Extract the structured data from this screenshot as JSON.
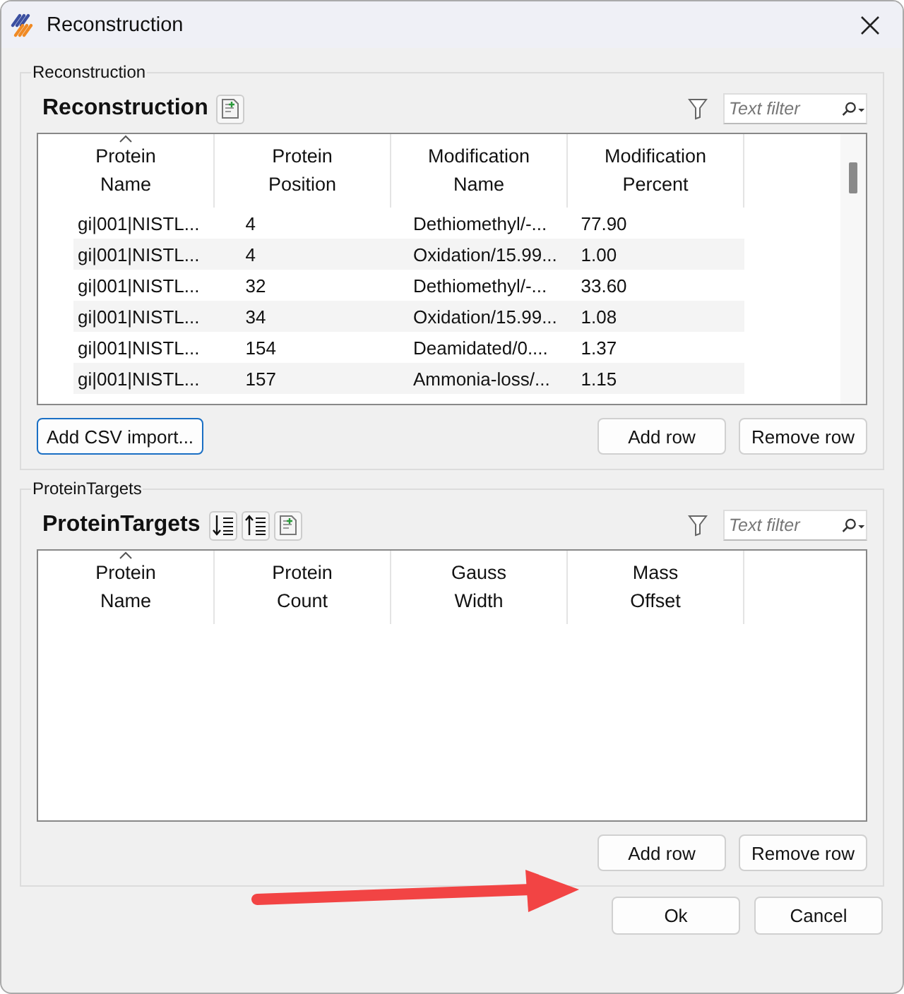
{
  "window": {
    "title": "Reconstruction"
  },
  "groups": [
    {
      "label": "Reconstruction",
      "title": "Reconstruction",
      "tools": [
        {
          "kind": "export"
        }
      ],
      "filter": {
        "placeholder": "Text filter"
      },
      "columns": [
        {
          "label": "Protein\nName",
          "sorted": true
        },
        {
          "label": "Protein\nPosition",
          "sorted": false
        },
        {
          "label": "Modification\nName",
          "sorted": false
        },
        {
          "label": "Modification\nPercent",
          "sorted": false
        }
      ],
      "rows": [
        [
          "gi|001|NISTL...",
          "4",
          "Dethiomethyl/-...",
          "77.90"
        ],
        [
          "gi|001|NISTL...",
          "4",
          "Oxidation/15.99...",
          "1.00"
        ],
        [
          "gi|001|NISTL...",
          "32",
          "Dethiomethyl/-...",
          "33.60"
        ],
        [
          "gi|001|NISTL...",
          "34",
          "Oxidation/15.99...",
          "1.08"
        ],
        [
          "gi|001|NISTL...",
          "154",
          "Deamidated/0....",
          "1.37"
        ],
        [
          "gi|001|NISTL...",
          "157",
          "Ammonia-loss/...",
          "1.15"
        ]
      ],
      "left_button": "Add CSV import...",
      "buttons": [
        "Add row",
        "Remove row"
      ]
    },
    {
      "label": "ProteinTargets",
      "title": "ProteinTargets",
      "tools": [
        {
          "kind": "sort-down"
        },
        {
          "kind": "sort-up"
        },
        {
          "kind": "export"
        }
      ],
      "filter": {
        "placeholder": "Text filter"
      },
      "columns": [
        {
          "label": "Protein\nName",
          "sorted": true
        },
        {
          "label": "Protein\nCount",
          "sorted": false
        },
        {
          "label": "Gauss\nWidth",
          "sorted": false
        },
        {
          "label": "Mass\nOffset",
          "sorted": false
        }
      ],
      "buttons": [
        "Add row",
        "Remove row"
      ]
    }
  ],
  "footer_buttons": [
    "Ok",
    "Cancel"
  ]
}
